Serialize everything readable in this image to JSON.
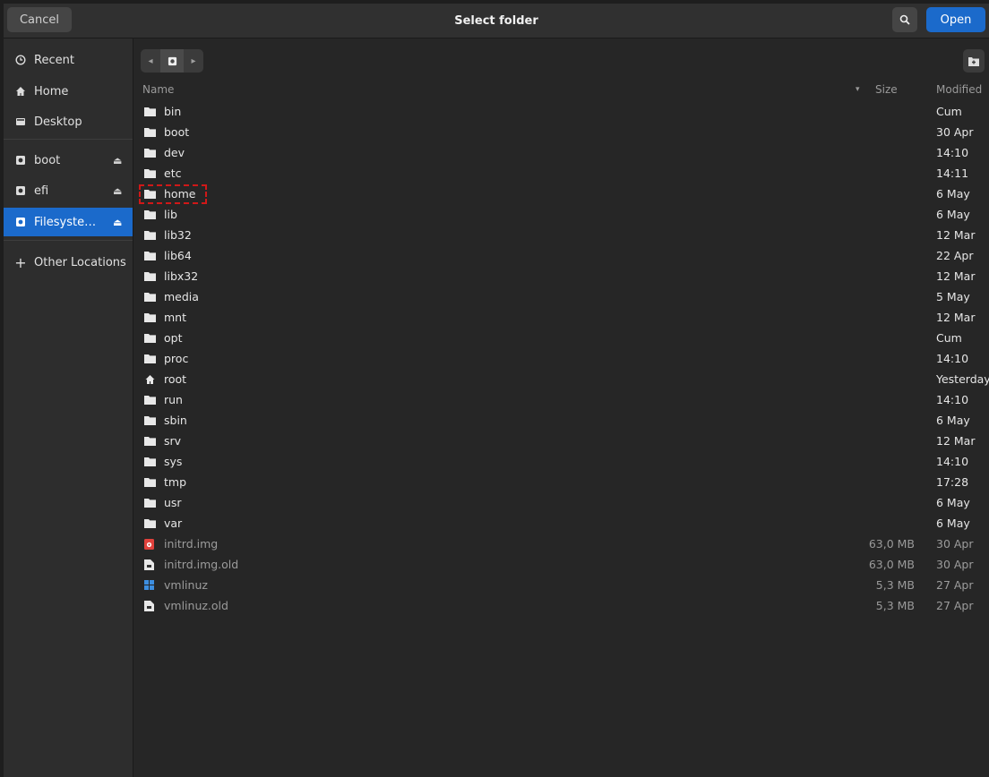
{
  "header": {
    "cancel_label": "Cancel",
    "title": "Select folder",
    "open_label": "Open"
  },
  "sidebar": {
    "items": [
      {
        "label": "Recent",
        "icon": "clock-icon"
      },
      {
        "label": "Home",
        "icon": "home-icon"
      },
      {
        "label": "Desktop",
        "icon": "desktop-icon"
      },
      {
        "label": "boot",
        "icon": "drive-icon",
        "eject": true
      },
      {
        "label": "efi",
        "icon": "drive-icon",
        "eject": true
      },
      {
        "label": "Filesyste…",
        "icon": "drive-icon",
        "eject": true,
        "active": true
      },
      {
        "label": "Other Locations",
        "icon": "plus-icon"
      }
    ]
  },
  "columns": {
    "name": "Name",
    "size": "Size",
    "modified": "Modified"
  },
  "files": [
    {
      "name": "bin",
      "size": "",
      "modified": "Cum",
      "type": "folder"
    },
    {
      "name": "boot",
      "size": "",
      "modified": "30 Apr",
      "type": "folder"
    },
    {
      "name": "dev",
      "size": "",
      "modified": "14:10",
      "type": "folder"
    },
    {
      "name": "etc",
      "size": "",
      "modified": "14:11",
      "type": "folder"
    },
    {
      "name": "home",
      "size": "",
      "modified": "6 May",
      "type": "folder",
      "highlighted": true
    },
    {
      "name": "lib",
      "size": "",
      "modified": "6 May",
      "type": "folder"
    },
    {
      "name": "lib32",
      "size": "",
      "modified": "12 Mar",
      "type": "folder"
    },
    {
      "name": "lib64",
      "size": "",
      "modified": "22 Apr",
      "type": "folder"
    },
    {
      "name": "libx32",
      "size": "",
      "modified": "12 Mar",
      "type": "folder"
    },
    {
      "name": "media",
      "size": "",
      "modified": "5 May",
      "type": "folder"
    },
    {
      "name": "mnt",
      "size": "",
      "modified": "12 Mar",
      "type": "folder"
    },
    {
      "name": "opt",
      "size": "",
      "modified": "Cum",
      "type": "folder"
    },
    {
      "name": "proc",
      "size": "",
      "modified": "14:10",
      "type": "folder"
    },
    {
      "name": "root",
      "size": "",
      "modified": "Yesterday",
      "type": "home"
    },
    {
      "name": "run",
      "size": "",
      "modified": "14:10",
      "type": "folder"
    },
    {
      "name": "sbin",
      "size": "",
      "modified": "6 May",
      "type": "folder"
    },
    {
      "name": "srv",
      "size": "",
      "modified": "12 Mar",
      "type": "folder"
    },
    {
      "name": "sys",
      "size": "",
      "modified": "14:10",
      "type": "folder"
    },
    {
      "name": "tmp",
      "size": "",
      "modified": "17:28",
      "type": "folder"
    },
    {
      "name": "usr",
      "size": "",
      "modified": "6 May",
      "type": "folder"
    },
    {
      "name": "var",
      "size": "",
      "modified": "6 May",
      "type": "folder"
    },
    {
      "name": "initrd.img",
      "size": "63,0 MB",
      "modified": "30 Apr",
      "type": "image-file"
    },
    {
      "name": "initrd.img.old",
      "size": "63,0 MB",
      "modified": "30 Apr",
      "type": "file"
    },
    {
      "name": "vmlinuz",
      "size": "5,3 MB",
      "modified": "27 Apr",
      "type": "exec-file"
    },
    {
      "name": "vmlinuz.old",
      "size": "5,3 MB",
      "modified": "27 Apr",
      "type": "file"
    }
  ],
  "colors": {
    "accent": "#1b6acb",
    "highlight_border": "#d01818"
  }
}
